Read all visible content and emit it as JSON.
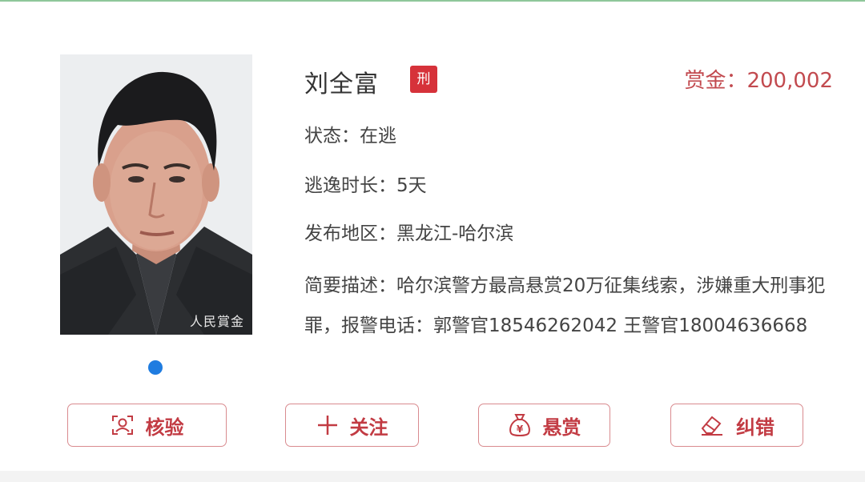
{
  "suspect": {
    "name": "刘全富",
    "badge": "刑",
    "reward_label": "赏金：",
    "reward_value": "200,002",
    "photo_watermark": "人民賞金"
  },
  "fields": {
    "status_label": "状态：",
    "status_value": "在逃",
    "duration_label": "逃逸时长：",
    "duration_value": "5天",
    "region_label": "发布地区：",
    "region_value": "黑龙江-哈尔滨",
    "desc_label": "简要描述：",
    "desc_value": "哈尔滨警方最高悬赏20万征集线索，涉嫌重大刑事犯罪，报警电话：郭警官18546262042 王警官18004636668"
  },
  "actions": {
    "verify": "核验",
    "follow": "关注",
    "reward": "悬赏",
    "correct": "纠错"
  },
  "icons": {
    "verify": "face-scan-icon",
    "follow": "plus-icon",
    "reward": "money-bag-icon",
    "correct": "eraser-icon"
  },
  "colors": {
    "accent": "#c23b43",
    "badge": "#d6323a",
    "carousel_dot": "#1f7ce0"
  }
}
